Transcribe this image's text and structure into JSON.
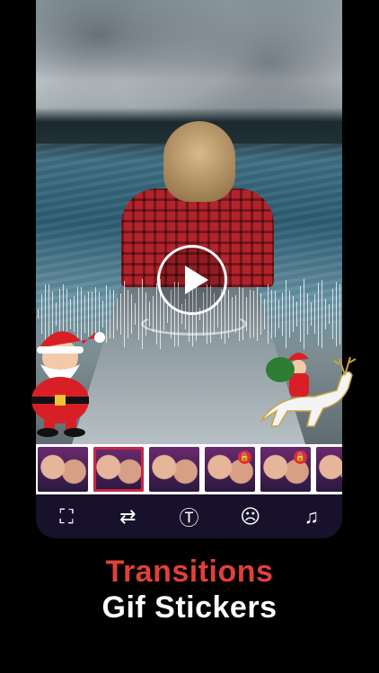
{
  "video": {
    "play_button_label": "Play"
  },
  "thumbnails": [
    {
      "locked": false,
      "selected": false
    },
    {
      "locked": false,
      "selected": true
    },
    {
      "locked": false,
      "selected": false
    },
    {
      "locked": true,
      "selected": false
    },
    {
      "locked": true,
      "selected": false
    },
    {
      "locked": false,
      "selected": false
    }
  ],
  "toolbar": {
    "items": [
      {
        "icon": "crop-icon",
        "glyph": "⛶"
      },
      {
        "icon": "transition-icon",
        "glyph": "⇄"
      },
      {
        "icon": "text-icon",
        "glyph": "Ⓣ"
      },
      {
        "icon": "emoji-icon",
        "glyph": "☹"
      },
      {
        "icon": "add-music-icon",
        "glyph": "♫"
      }
    ]
  },
  "promo": {
    "line1": "Transitions",
    "line2": "Gif Stickers"
  },
  "colors": {
    "accent_red": "#e0403a",
    "toolbar_bg": "#17112b"
  }
}
